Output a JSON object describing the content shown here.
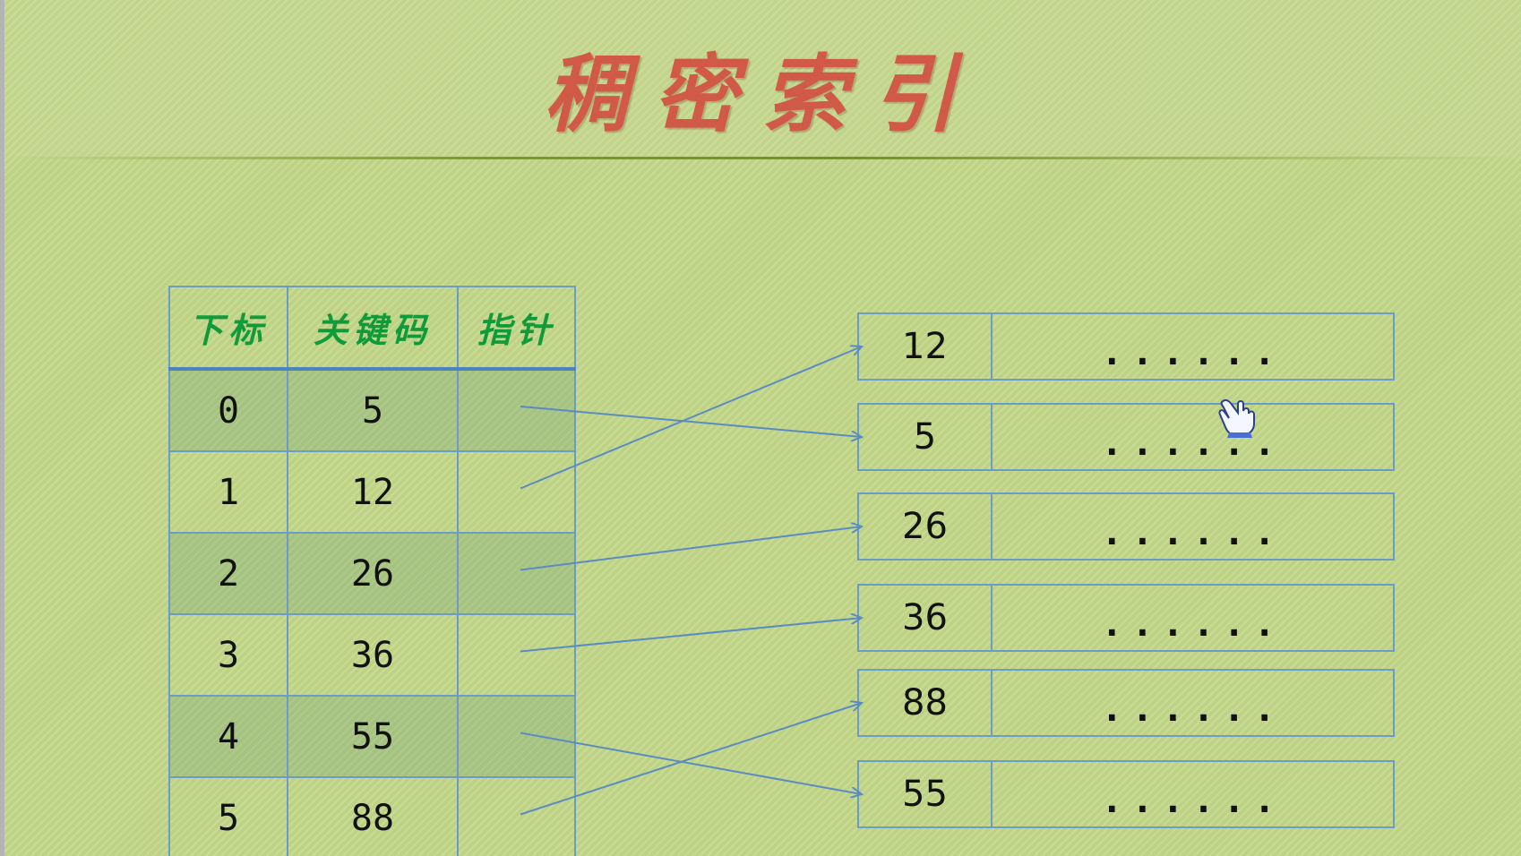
{
  "slide": {
    "title": "稠密索引",
    "table": {
      "headers": [
        "下标",
        "关键码",
        "指针"
      ],
      "rows": [
        {
          "index": "0",
          "key": "5"
        },
        {
          "index": "1",
          "key": "12"
        },
        {
          "index": "2",
          "key": "26"
        },
        {
          "index": "3",
          "key": "36"
        },
        {
          "index": "4",
          "key": "55"
        },
        {
          "index": "5",
          "key": "88"
        }
      ]
    },
    "records": [
      {
        "key": "12",
        "data": "......"
      },
      {
        "key": "5",
        "data": "......"
      },
      {
        "key": "26",
        "data": "......"
      },
      {
        "key": "36",
        "data": "......"
      },
      {
        "key": "88",
        "data": "......"
      },
      {
        "key": "55",
        "data": "......"
      }
    ],
    "pointer_map": [
      1,
      0,
      2,
      3,
      5,
      4
    ],
    "colors": {
      "background": "#c3d788",
      "title": "#d05a47",
      "header_text": "#109a3a",
      "border": "#6b9cc8",
      "arrow": "#5a8cc4"
    },
    "cursor_icon": "hand-pointer-icon"
  }
}
